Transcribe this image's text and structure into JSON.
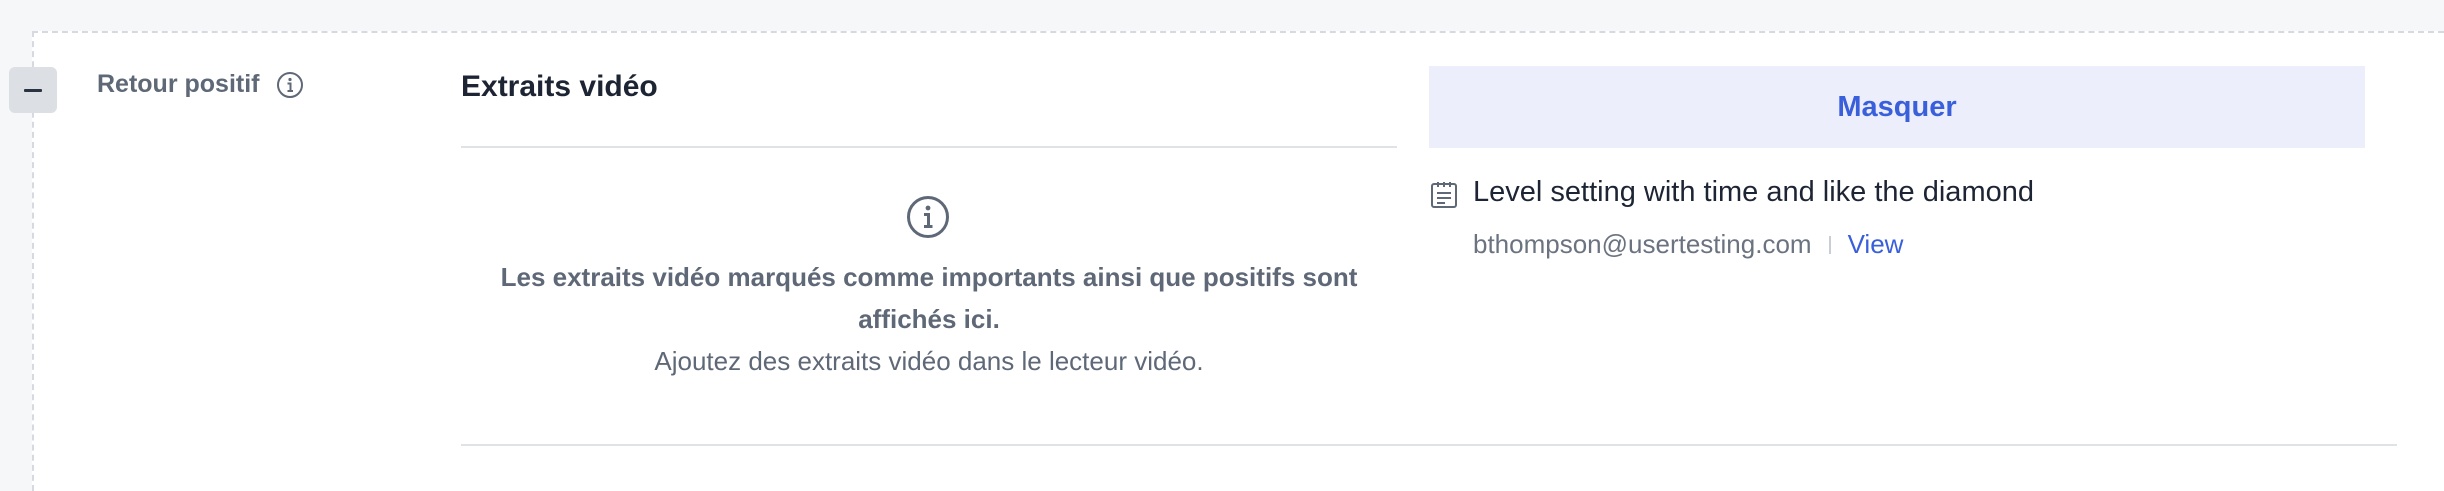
{
  "section": {
    "label": "Retour positif",
    "collapse_icon": "minus-icon",
    "info_icon": "info-icon"
  },
  "clips": {
    "title": "Extraits vidéo",
    "empty_icon": "info-icon",
    "empty_bold_line1": "Les extraits vidéo marqués comme importants ainsi que positifs sont",
    "empty_bold_line2": "affichés ici.",
    "empty_hint": "Ajoutez des extraits vidéo dans le lecteur vidéo."
  },
  "notes": {
    "hide_label": "Masquer",
    "items": [
      {
        "icon": "note-icon",
        "title": "Level setting with time and like the diamond",
        "author": "bthompson@usertesting.com",
        "view_label": "View"
      }
    ]
  },
  "colors": {
    "accent": "#3a5fdb",
    "hide_bg": "#eceffb",
    "muted_text": "#5f6877"
  }
}
